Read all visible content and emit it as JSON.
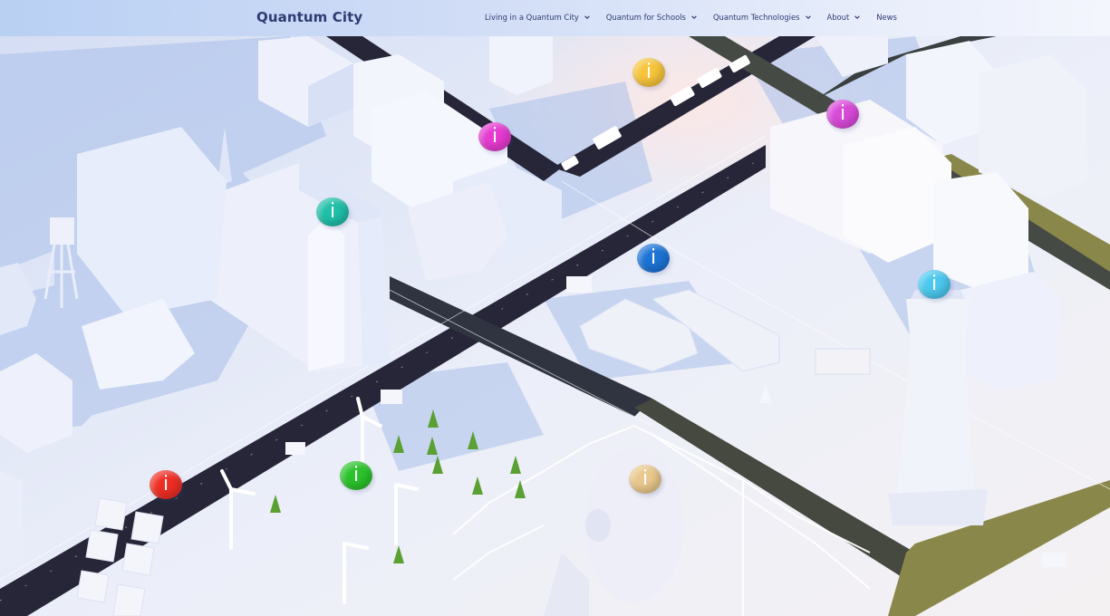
{
  "header": {
    "brand": "Quantum City",
    "nav": [
      {
        "label": "Living in a Quantum City",
        "has_dropdown": true
      },
      {
        "label": "Quantum for Schools",
        "has_dropdown": true
      },
      {
        "label": "Quantum Technologies",
        "has_dropdown": true
      },
      {
        "label": "About",
        "has_dropdown": true
      },
      {
        "label": "News",
        "has_dropdown": false
      }
    ]
  },
  "hotspots": [
    {
      "name": "info-hotspot-yellow-top",
      "glyph": "i",
      "color": "#f7c43a"
    },
    {
      "name": "info-hotspot-magenta-center",
      "glyph": "i",
      "color": "#e63ad0"
    },
    {
      "name": "info-hotspot-magenta-right",
      "glyph": "i",
      "color": "#d94ad9"
    },
    {
      "name": "info-hotspot-teal",
      "glyph": "i",
      "color": "#1fbfa8"
    },
    {
      "name": "info-hotspot-blue",
      "glyph": "i",
      "color": "#1c73d6"
    },
    {
      "name": "info-hotspot-cyan",
      "glyph": "i",
      "color": "#4cc8ef"
    },
    {
      "name": "info-hotspot-red",
      "glyph": "i",
      "color": "#ee2e24"
    },
    {
      "name": "info-hotspot-green",
      "glyph": "i",
      "color": "#2bc22b"
    },
    {
      "name": "info-hotspot-tan",
      "glyph": "i",
      "color": "#e8c88c"
    }
  ],
  "colors": {
    "road_dark": "#262638",
    "road_olive": "#8a874a",
    "ground": "#e8ebf7",
    "building": "#f4f6ff",
    "shadow": "#a7bde8",
    "tree": "#5aa032"
  }
}
